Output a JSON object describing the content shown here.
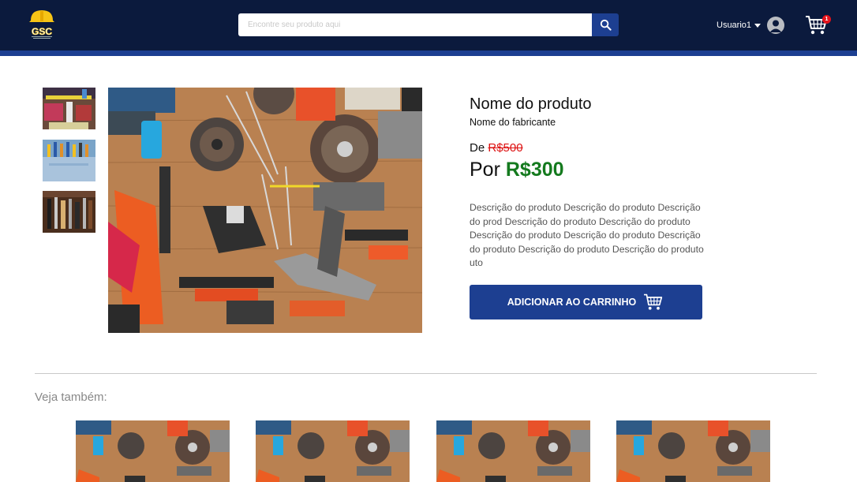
{
  "header": {
    "logo_text": "GSC",
    "search": {
      "placeholder": "Encontre seu produto aqui",
      "value": ""
    },
    "user": {
      "name": "Usuario1"
    },
    "cart": {
      "count": "1"
    },
    "colors": {
      "navy": "#0b1a3d",
      "accent": "#1d3f91",
      "badge": "#e3131b"
    }
  },
  "gallery": {
    "thumbnails": [
      "thumb-tools-1",
      "thumb-tools-2",
      "thumb-tools-3"
    ]
  },
  "product": {
    "name": "Nome do produto",
    "manufacturer": "Nome do fabricante",
    "old_prefix": "De",
    "old_price": "R$500",
    "new_prefix": "Por",
    "new_price": "R$300",
    "description": "Descrição do produto Descrição do produto Descrição do prod Descrição do produto Descrição do produto Descrição do produto Descrição do produto Descrição do produto Descrição do produto Descrição do produto uto",
    "add_button": "ADICIONAR AO CARRINHO",
    "colors": {
      "price": "#147a1e",
      "strike": "#d11111"
    }
  },
  "related": {
    "title": "Veja também:",
    "items": [
      "related-1",
      "related-2",
      "related-3",
      "related-4"
    ]
  }
}
